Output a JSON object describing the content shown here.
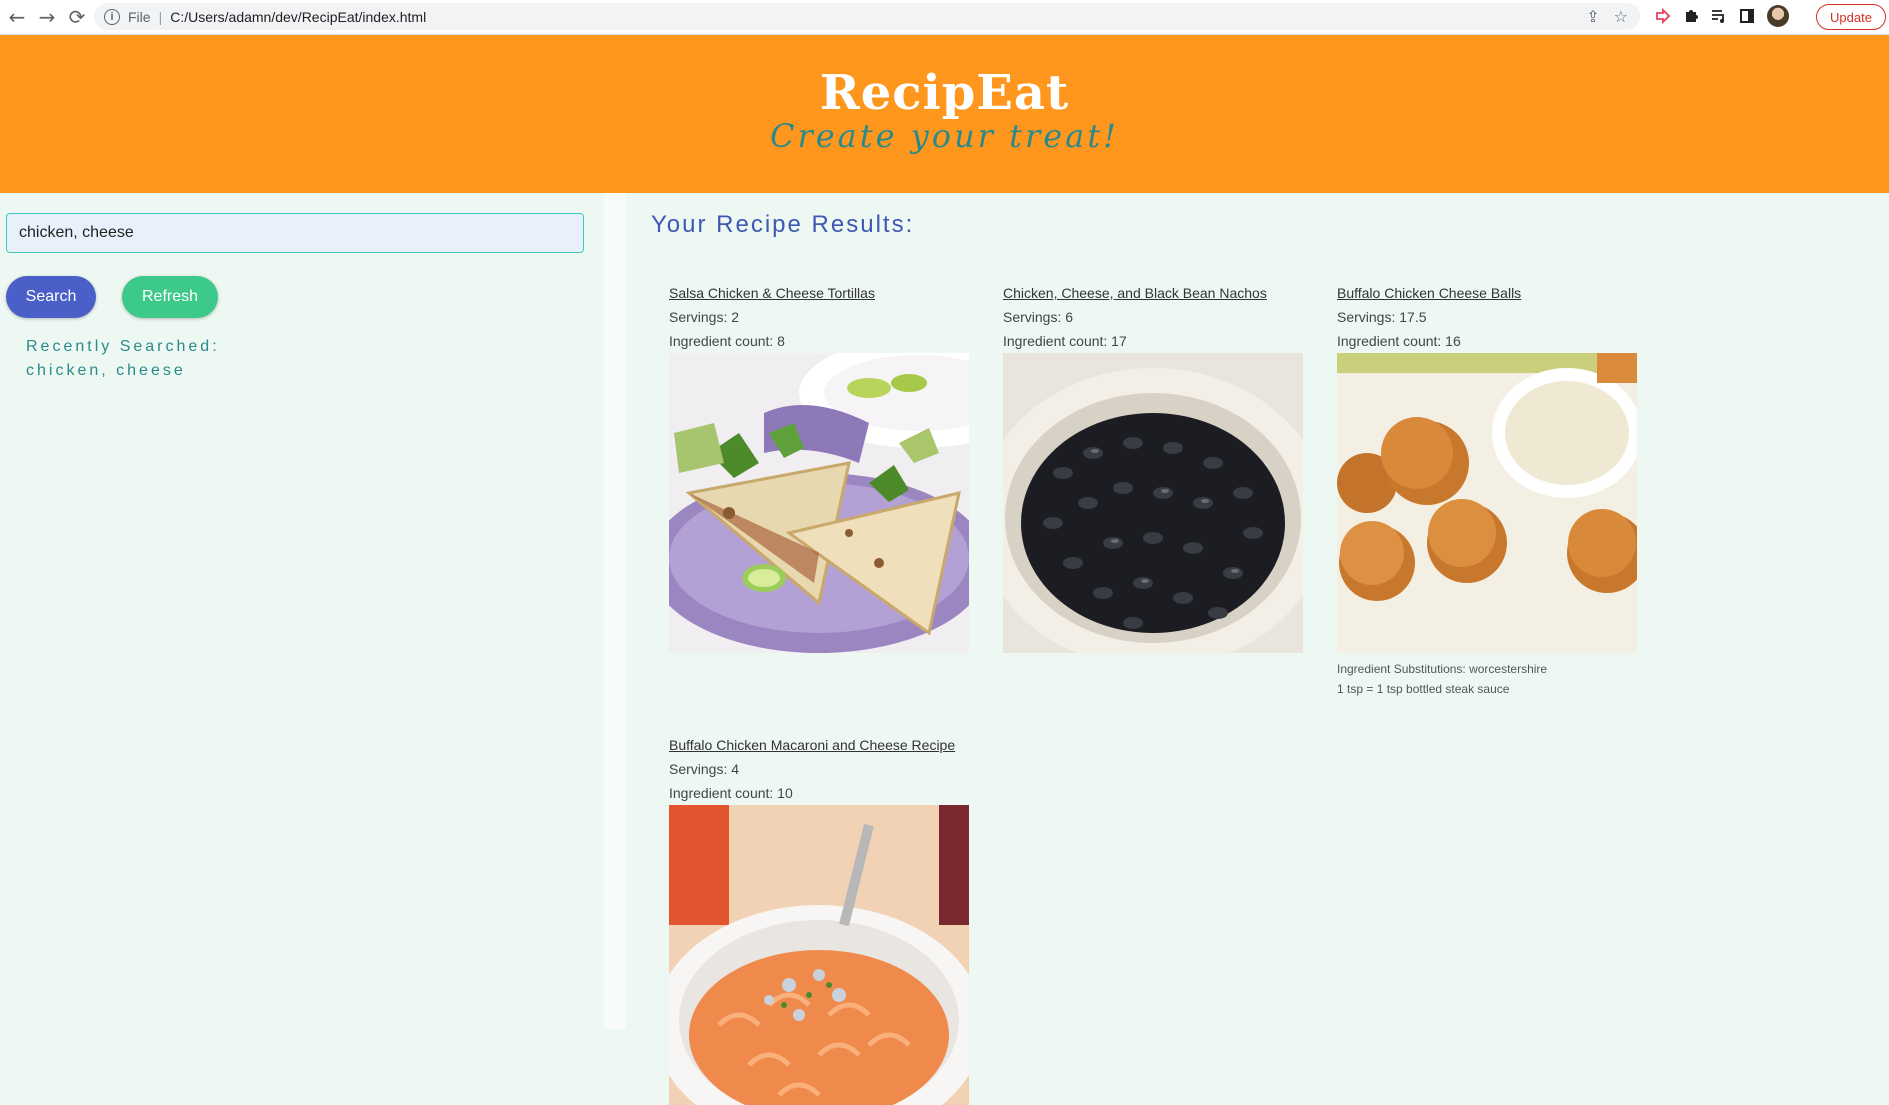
{
  "browser": {
    "back_icon": "←",
    "forward_icon": "→",
    "reload_icon": "⟳",
    "protocol": "File",
    "url": "C:/Users/adamn/dev/RecipEat/index.html",
    "share_icon": "⇪",
    "star_icon": "☆",
    "update_label": "Update"
  },
  "header": {
    "brand": "RecipEat",
    "tagline": "Create your treat!",
    "background": "#ff971f"
  },
  "sidebar": {
    "search_value": "chicken, cheese",
    "search_button": "Search",
    "refresh_button": "Refresh",
    "recent_label": "Recently Searched:",
    "recent_items": [
      "chicken, cheese"
    ]
  },
  "results": {
    "title": "Your Recipe Results:",
    "cards": [
      {
        "title": "Salsa Chicken & Cheese Tortillas",
        "servings": "Servings: 2",
        "ingredients": "Ingredient count: 8",
        "image": "quesadilla-photo"
      },
      {
        "title": "Chicken, Cheese, and Black Bean Nachos",
        "servings": "Servings: 6",
        "ingredients": "Ingredient count: 17",
        "image": "black-beans-photo"
      },
      {
        "title": "Buffalo Chicken Cheese Balls",
        "servings": "Servings: 17.5",
        "ingredients": "Ingredient count: 16",
        "image": "cheese-balls-photo",
        "substitution_line1": "Ingredient Substitutions: worcestershire",
        "substitution_line2": "1 tsp = 1 tsp bottled steak sauce"
      },
      {
        "title": "Buffalo Chicken Macaroni and Cheese Recipe",
        "servings": "Servings: 4",
        "ingredients": "Ingredient count: 10",
        "image": "mac-cheese-photo"
      }
    ]
  }
}
